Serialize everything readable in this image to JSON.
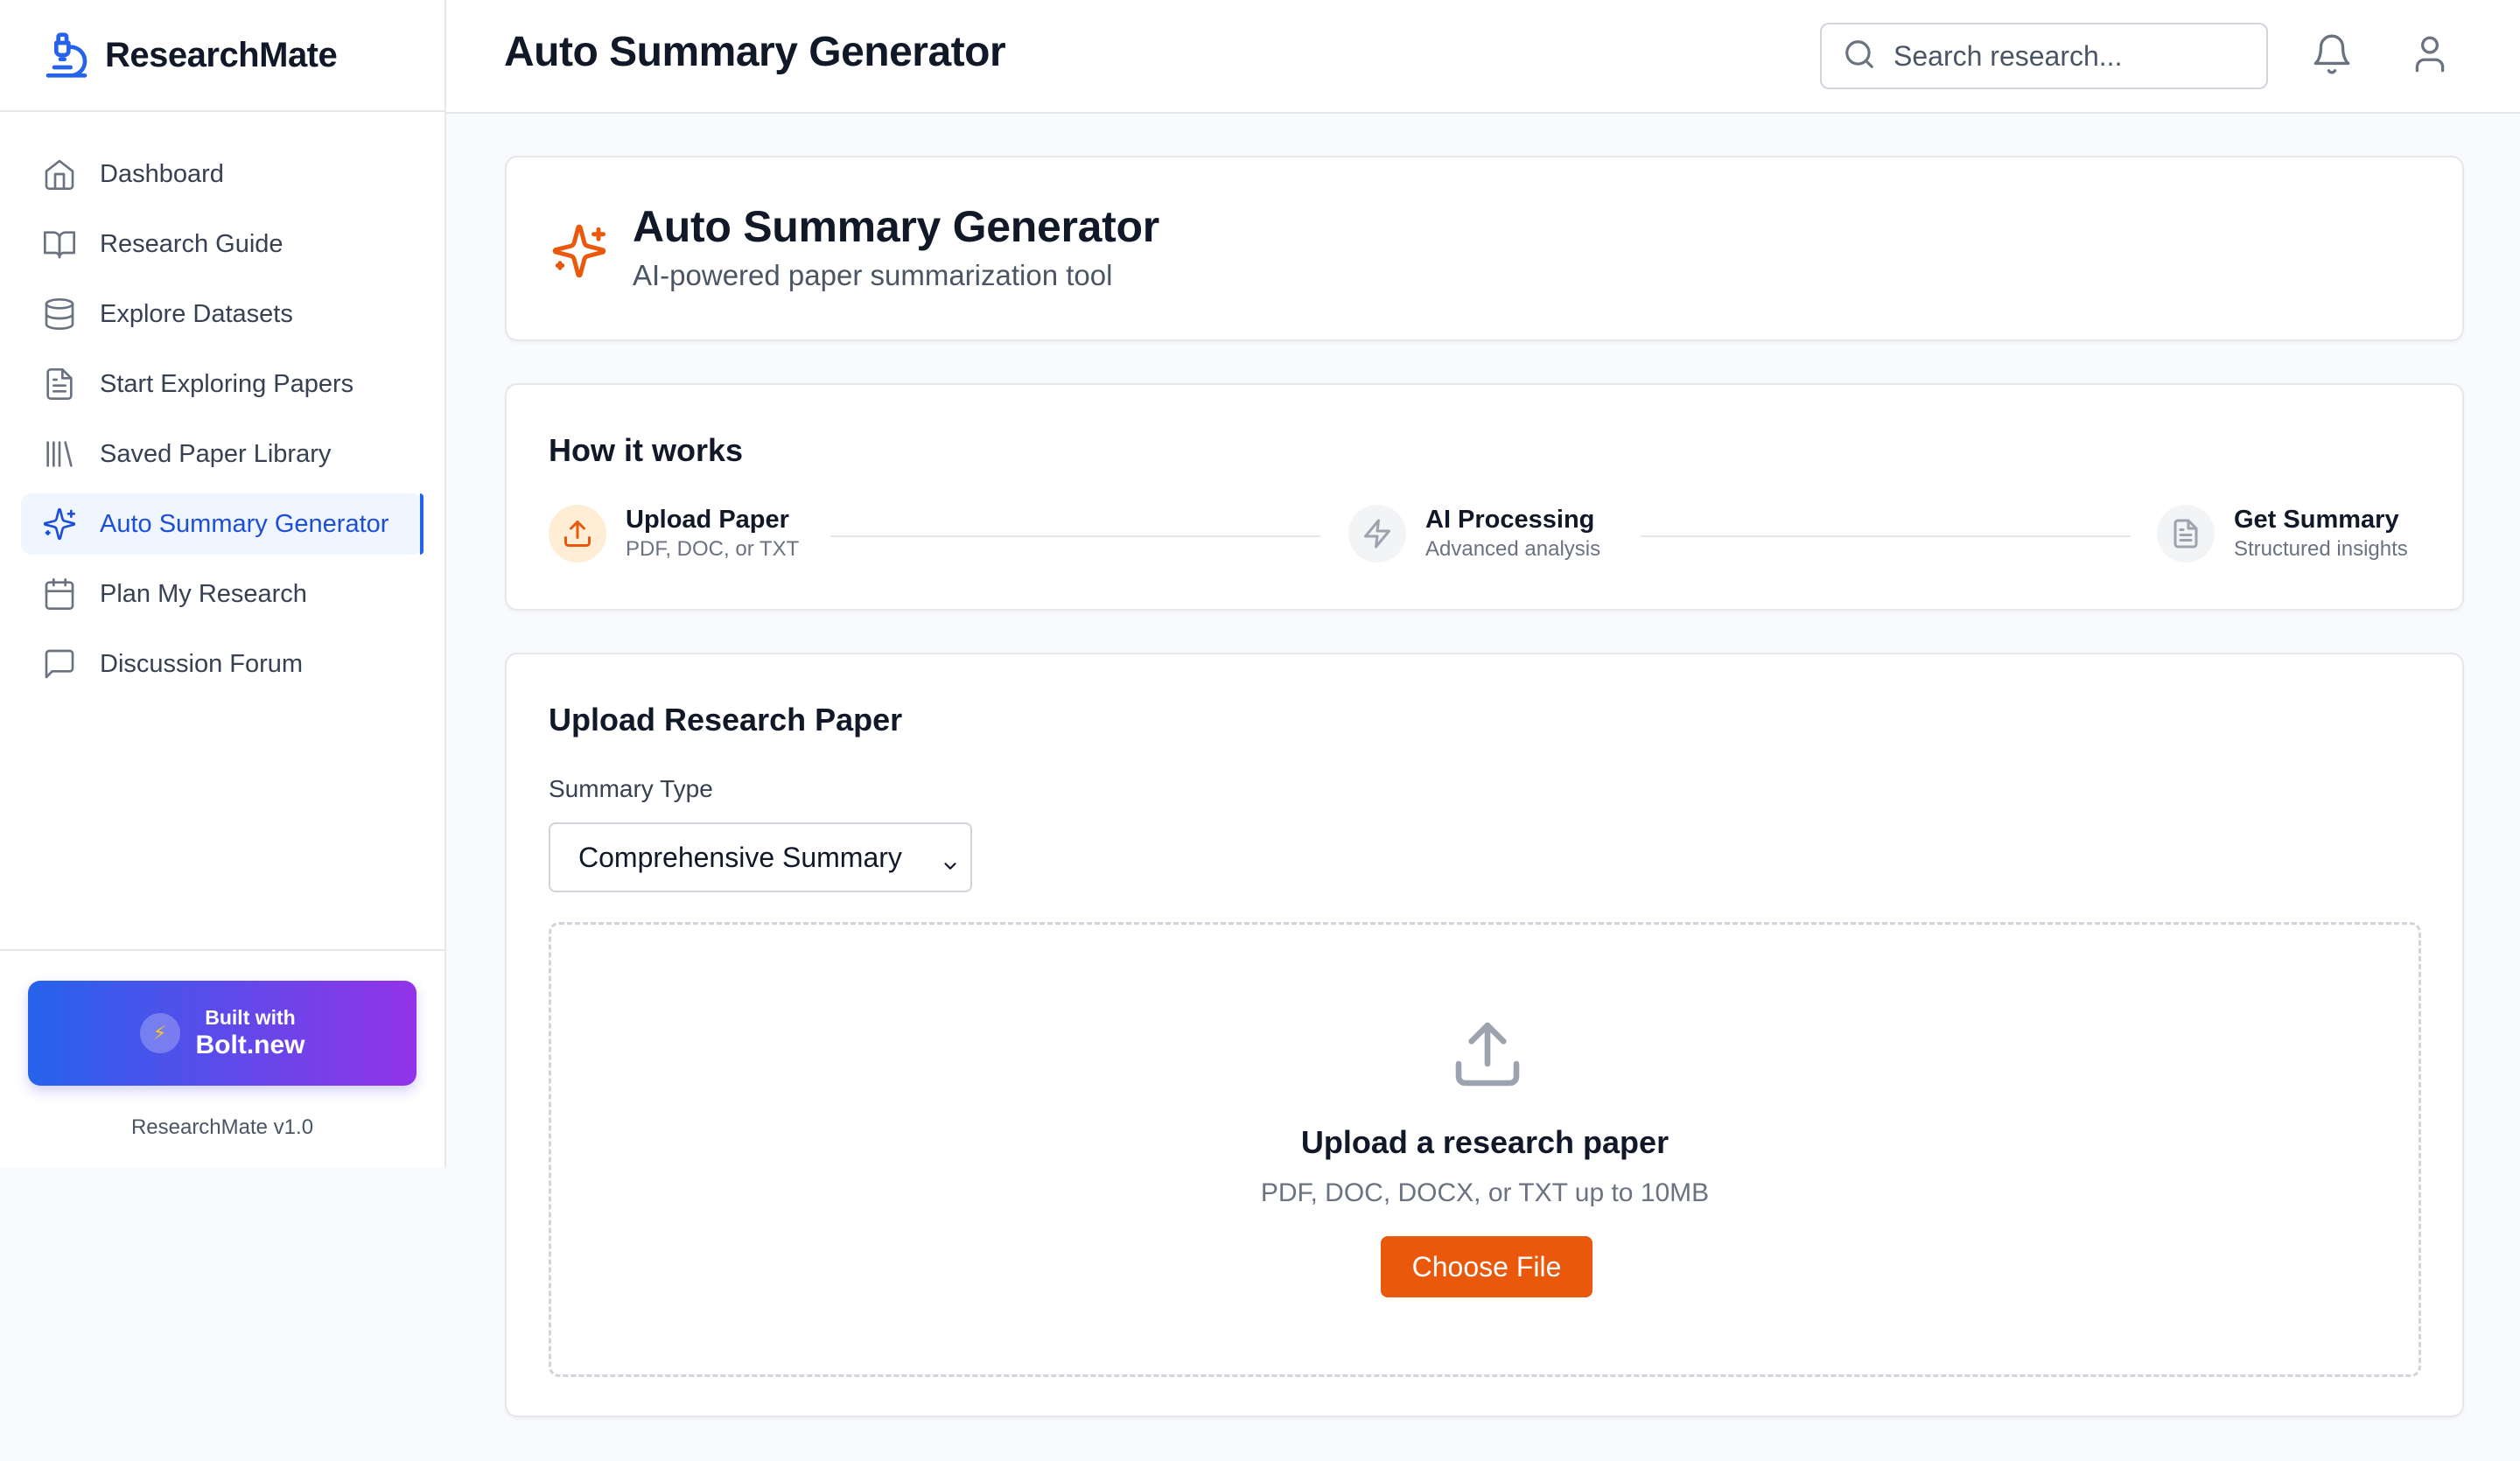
{
  "app": {
    "name": "ResearchMate",
    "version": "ResearchMate v1.0"
  },
  "sidebar": {
    "items": [
      {
        "label": "Dashboard",
        "icon": "home-icon"
      },
      {
        "label": "Research Guide",
        "icon": "book-open-icon"
      },
      {
        "label": "Explore Datasets",
        "icon": "database-icon"
      },
      {
        "label": "Start Exploring Papers",
        "icon": "file-text-icon"
      },
      {
        "label": "Saved Paper Library",
        "icon": "library-icon"
      },
      {
        "label": "Auto Summary Generator",
        "icon": "sparkles-icon",
        "active": true
      },
      {
        "label": "Plan My Research",
        "icon": "calendar-icon"
      },
      {
        "label": "Discussion Forum",
        "icon": "message-square-icon"
      }
    ],
    "bolt": {
      "top": "Built with",
      "bottom": "Bolt.new"
    }
  },
  "header": {
    "title": "Auto Summary Generator",
    "search_placeholder": "Search research..."
  },
  "intro": {
    "title": "Auto Summary Generator",
    "subtitle": "AI-powered paper summarization tool"
  },
  "how_it_works": {
    "title": "How it works",
    "steps": [
      {
        "name": "Upload Paper",
        "desc": "PDF, DOC, or TXT"
      },
      {
        "name": "AI Processing",
        "desc": "Advanced analysis"
      },
      {
        "name": "Get Summary",
        "desc": "Structured insights"
      }
    ]
  },
  "upload": {
    "title": "Upload Research Paper",
    "summary_type_label": "Summary Type",
    "summary_type_value": "Comprehensive Summary",
    "dropzone_title": "Upload a research paper",
    "dropzone_sub": "PDF, DOC, DOCX, or TXT up to 10MB",
    "choose_button": "Choose File"
  },
  "colors": {
    "accent_blue": "#2563eb",
    "accent_orange": "#ea580c",
    "bolt_gradient_start": "#2563eb",
    "bolt_gradient_end": "#9333ea"
  }
}
